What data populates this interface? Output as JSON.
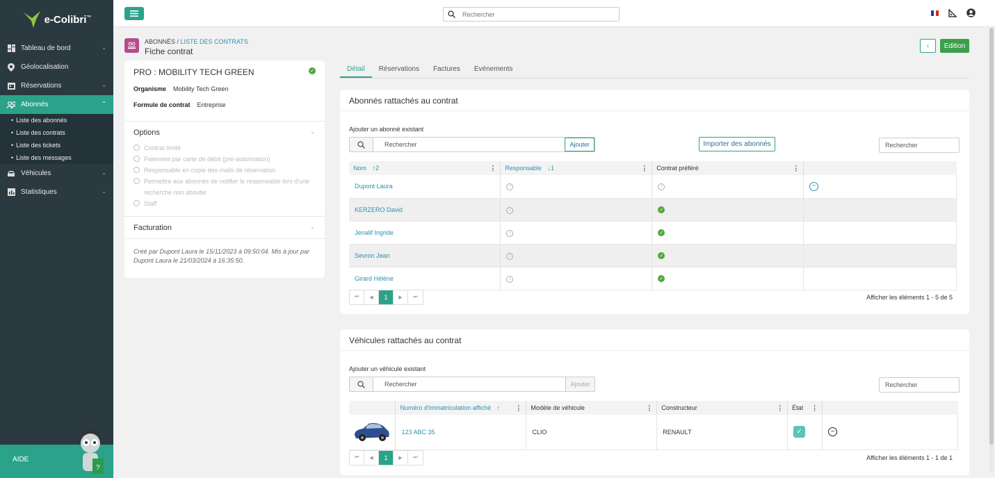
{
  "app": {
    "name": "e-Colibri",
    "tm": "™"
  },
  "sidebar": {
    "items": [
      {
        "label": "Tableau de bord"
      },
      {
        "label": "Géolocalisation"
      },
      {
        "label": "Réservations"
      },
      {
        "label": "Abonnés"
      },
      {
        "label": "Véhicules"
      },
      {
        "label": "Statistiques"
      }
    ],
    "sub": [
      "Liste des abonnés",
      "Liste des contrats",
      "Liste des tickets",
      "Liste des messages"
    ],
    "aide": "AIDE"
  },
  "topbar": {
    "search_placeholder": "Rechercher"
  },
  "breadcrumb": {
    "root": "ABONNÉS",
    "sep": " / ",
    "current": "LISTE DES CONTRATS",
    "title": "Fiche contrat"
  },
  "actions": {
    "back": "‹",
    "edit": "Edition"
  },
  "contract": {
    "title": "PRO : MOBILITY TECH GREEN",
    "org_label": "Organisme",
    "org_value": "Mobility Tech Green",
    "formule_label": "Formule de contrat",
    "formule_value": "Entreprise",
    "options_title": "Options",
    "options": [
      "Contrat limité",
      "Paiement par carte de débit (pré-autorisation)",
      "Responsable en copie des mails de réservation",
      "Permettre aux abonnés de notifier le responsable lors d'une recherche non aboutie",
      "Staff"
    ],
    "facturation_title": "Facturation",
    "created": "Créé par Dupont Laura le 15/11/2023 à 09:50:04. Mis à jour par Dupont Laura le 21/03/2024 à 16:35:50."
  },
  "tabs": [
    "Détail",
    "Réservations",
    "Factures",
    "Evènements"
  ],
  "abonnes": {
    "title": "Abonnés rattachés au contrat",
    "add_label": "Ajouter un abonné existant",
    "search_placeholder": "Rechercher",
    "add_btn": "Ajouter",
    "import_btn": "Importer des abonnés",
    "filter_placeholder": "Rechercher",
    "columns": [
      {
        "label": "Nom",
        "sort": "↑2"
      },
      {
        "label": "Responsable",
        "sort": "↓1"
      },
      {
        "label": "Contrat préféré",
        "sort": ""
      }
    ],
    "rows": [
      {
        "nom": "Dupont Laura",
        "prefere": false,
        "remove": true
      },
      {
        "nom": "KERZERO David",
        "prefere": true,
        "remove": false
      },
      {
        "nom": "Jenalif Ingride",
        "prefere": true,
        "remove": false
      },
      {
        "nom": "Sevron Jean",
        "prefere": true,
        "remove": false
      },
      {
        "nom": "Girard Hélène",
        "prefere": true,
        "remove": false
      }
    ],
    "page": "1",
    "count": "Afficher les éléments 1 - 5 de 5"
  },
  "vehicules": {
    "title": "Véhicules rattachés au contrat",
    "add_label": "Ajouter un véhicule existant",
    "search_placeholder": "Rechercher",
    "add_btn": "Ajouter",
    "filter_placeholder": "Rechercher",
    "columns": [
      "Numéro d'immatriculation affiché",
      "Modèle de véhicule",
      "Constructeur",
      "État"
    ],
    "sort": "↑",
    "rows": [
      {
        "immat": "123 ABC 35",
        "modele": "CLIO",
        "constructeur": "RENAULT"
      }
    ],
    "page": "1",
    "count": "Afficher les éléments 1 - 1 de 1"
  },
  "colors": {
    "accent": "#2aa38a",
    "sidebar": "#2b3a40",
    "ok": "#52a83a"
  }
}
